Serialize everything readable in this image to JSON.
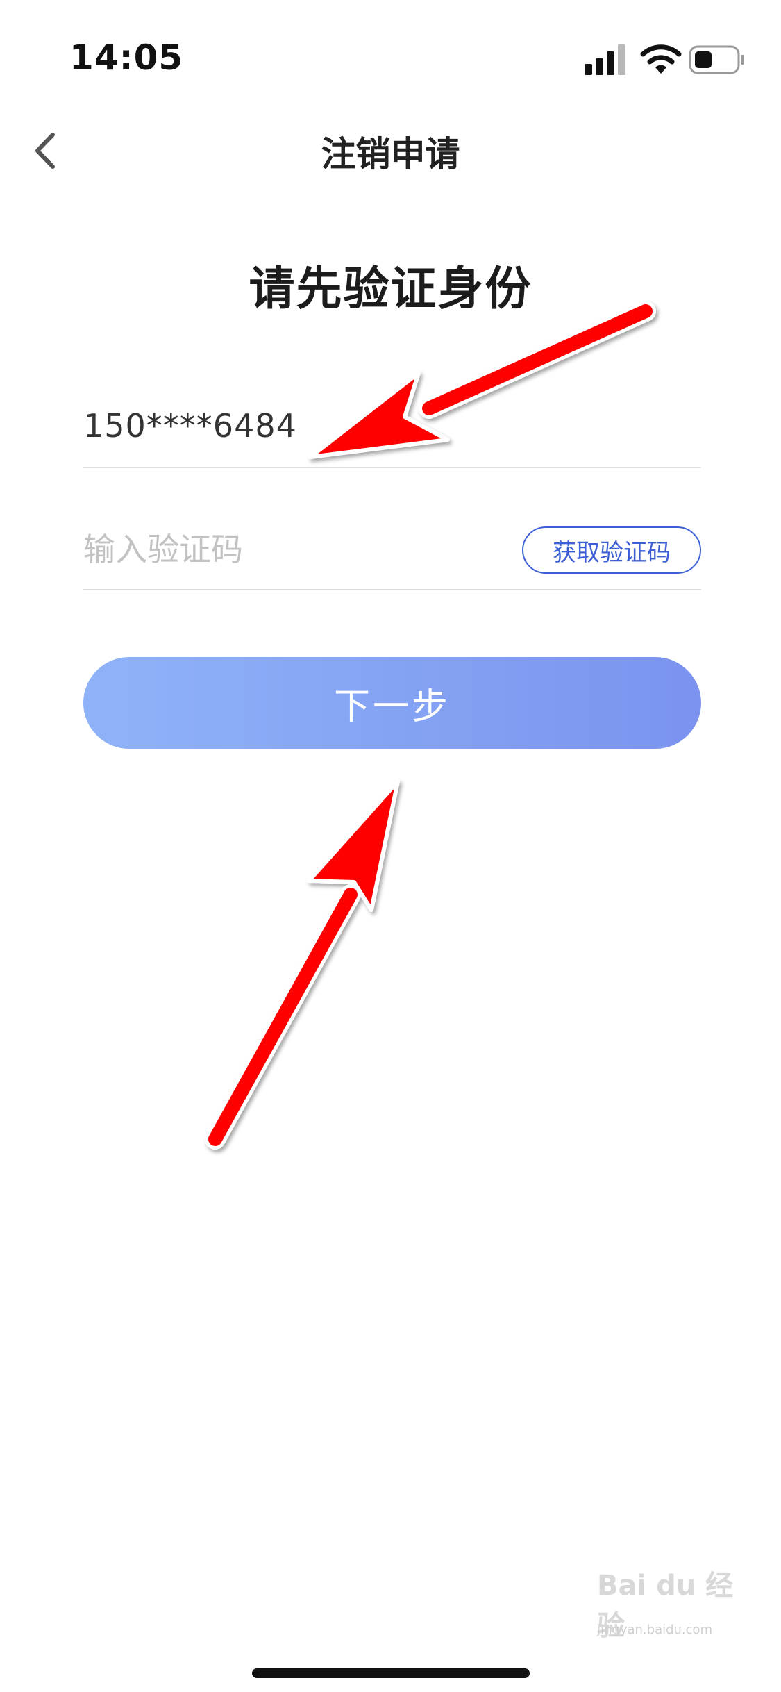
{
  "status_bar": {
    "time": "14:05",
    "icons": [
      "signal-icon",
      "wifi-icon",
      "battery-icon"
    ]
  },
  "nav": {
    "back_icon": "chevron-left-icon",
    "title": "注销申请"
  },
  "heading": "请先验证身份",
  "phone_field": {
    "value": "150****6484"
  },
  "code_field": {
    "placeholder": "输入验证码",
    "button_label": "获取验证码"
  },
  "next_button": {
    "label": "下一步"
  },
  "watermark": {
    "text": "Bai du 经验",
    "sub": "jingyan.baidu.com"
  },
  "colors": {
    "accent": "#3d5fd6",
    "button_gradient_start": "#8fb3f8",
    "button_gradient_end": "#7b93ef",
    "annotation_arrow": "#ff0000"
  }
}
